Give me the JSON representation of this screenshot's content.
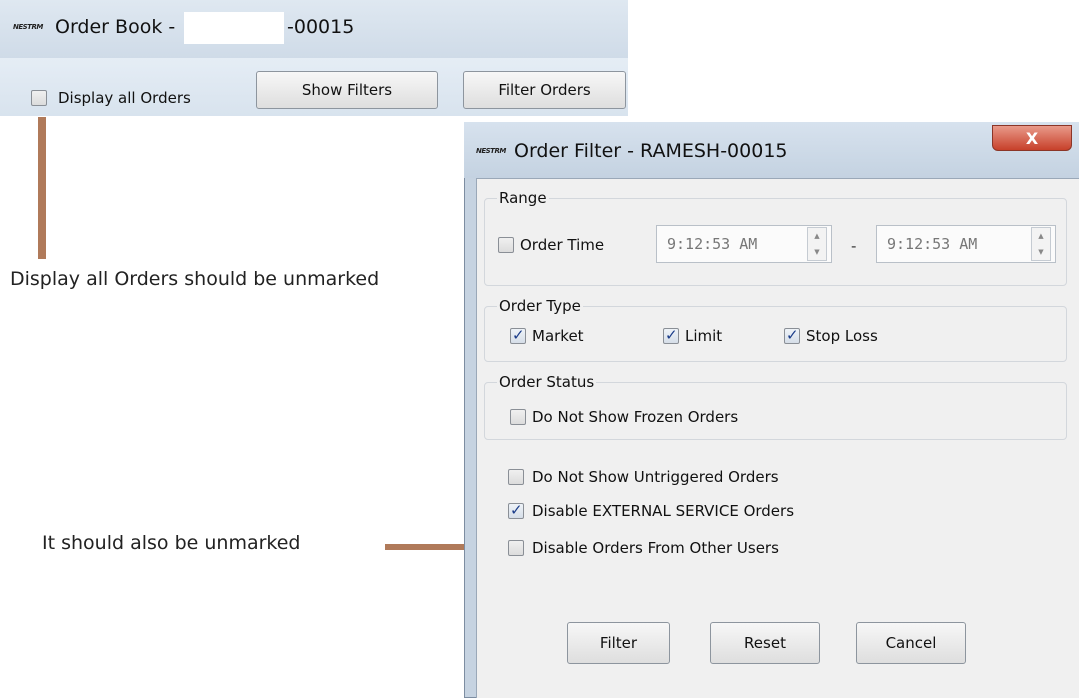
{
  "order_book": {
    "logo_text": "NESTRM",
    "title_prefix": "Order Book -",
    "title_suffix": "-00015",
    "display_all_orders": {
      "label": "Display all Orders",
      "checked": false
    },
    "show_filters_label": "Show Filters",
    "filter_orders_label": "Filter Orders"
  },
  "dialog": {
    "logo_text": "NESTRM",
    "title": "Order Filter - RAMESH-00015",
    "close_symbol": "X",
    "range": {
      "legend": "Range",
      "order_time_label": "Order Time",
      "order_time_checked": false,
      "from_time": "9:12:53 AM",
      "separator": "-",
      "to_time": "9:12:53 AM"
    },
    "order_type": {
      "legend": "Order Type",
      "market": {
        "label": "Market",
        "checked": true
      },
      "limit": {
        "label": "Limit",
        "checked": true
      },
      "stop_loss": {
        "label": "Stop Loss",
        "checked": true
      }
    },
    "order_status": {
      "legend": "Order Status",
      "frozen": {
        "label": "Do Not Show Frozen Orders",
        "checked": false
      }
    },
    "untriggered": {
      "label": "Do Not Show Untriggered Orders",
      "checked": false
    },
    "external_service": {
      "label": "Disable EXTERNAL SERVICE Orders",
      "checked": true
    },
    "other_users": {
      "label": "Disable Orders From Other Users",
      "checked": false
    },
    "buttons": {
      "filter": "Filter",
      "reset": "Reset",
      "cancel": "Cancel"
    }
  },
  "annotations": {
    "note1": "Display all Orders should be unmarked",
    "note2": "It should also be unmarked",
    "arrow_color": "#b07a5a"
  }
}
